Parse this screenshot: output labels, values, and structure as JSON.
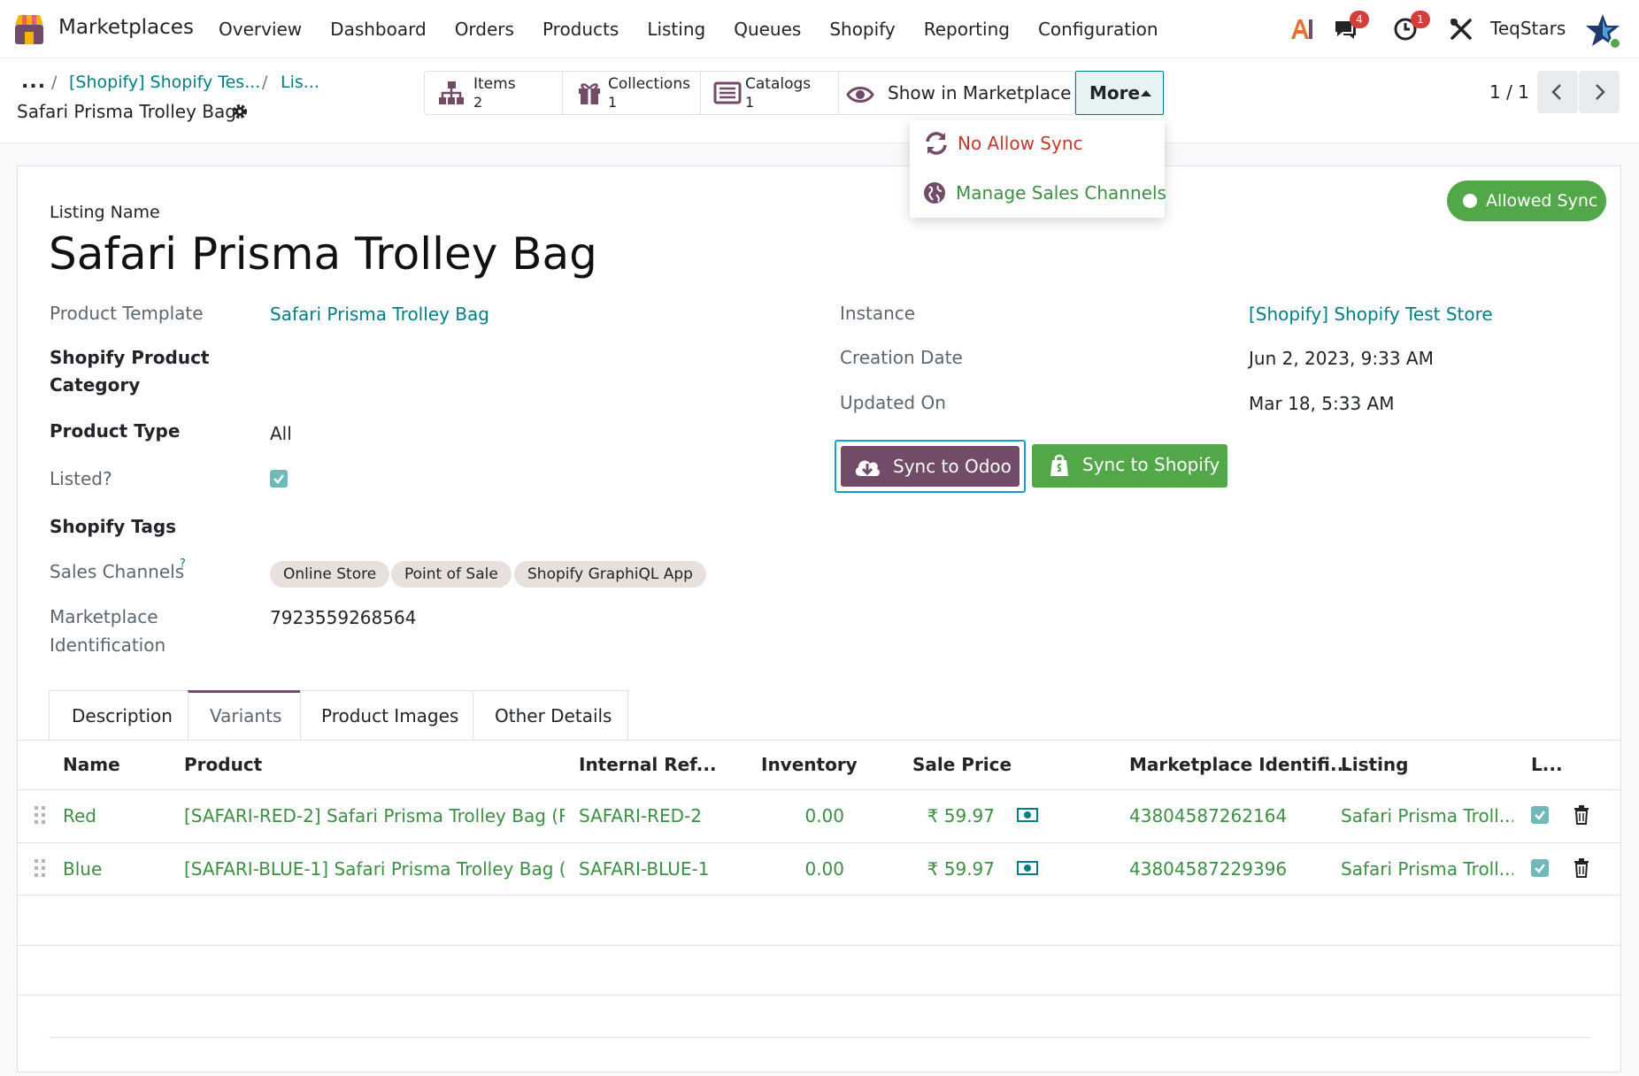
{
  "navbar": {
    "app_name": "Marketplaces",
    "menu": [
      "Overview",
      "Dashboard",
      "Orders",
      "Products",
      "Listing",
      "Queues",
      "Shopify",
      "Reporting",
      "Configuration"
    ],
    "messages_badge": "4",
    "activities_badge": "1",
    "company": "TeqStars"
  },
  "breadcrumb": {
    "dots": "...",
    "crumb1": "[Shopify] Shopify Tes...",
    "crumb2": "Lis...",
    "current": "Safari Prisma Trolley Bag"
  },
  "smart_buttons": [
    {
      "label": "Items",
      "value": "2",
      "icon": "hierarchy-icon"
    },
    {
      "label": "Collections",
      "value": "1",
      "icon": "gift-icon"
    },
    {
      "label": "Catalogs",
      "value": "1",
      "icon": "list-icon"
    }
  ],
  "show_marketplace": "Show in Marketplace",
  "more": "More",
  "pager": "1 / 1",
  "dropdown": {
    "no_allow_sync": "No Allow Sync",
    "manage_sales_channels": "Manage Sales Channels"
  },
  "status": "Allowed Sync",
  "form": {
    "listing_name_label": "Listing Name",
    "listing_name": "Safari Prisma Trolley Bag",
    "product_template_label": "Product Template",
    "product_template": "Safari Prisma Trolley Bag",
    "category_label_1": "Shopify Product",
    "category_label_2": "Category",
    "product_type_label": "Product Type",
    "product_type": "All",
    "listed_label": "Listed?",
    "tags_label": "Shopify Tags",
    "sales_channels_label": "Sales Channels",
    "help": "?",
    "sales_channels": [
      "Online Store",
      "Point of Sale",
      "Shopify GraphiQL App"
    ],
    "mp_id_label_1": "Marketplace",
    "mp_id_label_2": "Identification",
    "mp_id": "7923559268564",
    "instance_label": "Instance",
    "instance": "[Shopify] Shopify Test Store",
    "creation_label": "Creation Date",
    "creation": "Jun 2, 2023, 9:33 AM",
    "updated_label": "Updated On",
    "updated": "Mar 18, 5:33 AM",
    "sync_odoo": "Sync to Odoo",
    "sync_shopify": "Sync to Shopify"
  },
  "tabs": [
    "Description",
    "Variants",
    "Product Images",
    "Other Details"
  ],
  "table": {
    "headers": [
      "Name",
      "Product",
      "Internal Ref...",
      "Inventory",
      "Sale Price",
      "Marketplace Identifi...",
      "Listing",
      "L..."
    ],
    "rows": [
      {
        "name": "Red",
        "product": "[SAFARI-RED-2] Safari Prisma Trolley Bag (R...",
        "ref": "SAFARI-RED-2",
        "inventory": "0.00",
        "price": "₹ 59.97",
        "mp_id": "43804587262164",
        "listing": "Safari Prisma Troll..."
      },
      {
        "name": "Blue",
        "product": "[SAFARI-BLUE-1] Safari Prisma Trolley Bag (...",
        "ref": "SAFARI-BLUE-1",
        "inventory": "0.00",
        "price": "₹ 59.97",
        "mp_id": "43804587229396",
        "listing": "Safari Prisma Troll..."
      }
    ]
  },
  "colors": {
    "primary": "#714b67",
    "link": "#017e84",
    "success": "#52a849",
    "danger": "#c0392b"
  }
}
